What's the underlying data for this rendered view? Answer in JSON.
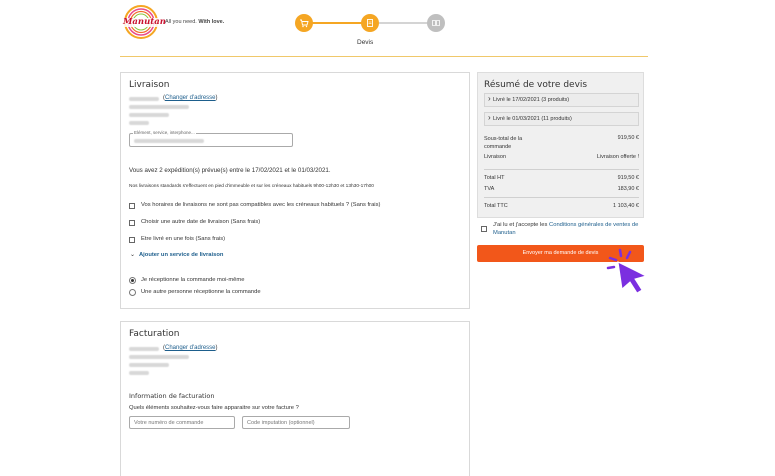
{
  "header": {
    "logo_text": "Manutan",
    "tagline_prefix": "All you need.",
    "tagline_bold": "With love.",
    "steps": [
      {
        "name": "cart",
        "state": "done"
      },
      {
        "name": "quote",
        "state": "active"
      },
      {
        "name": "confirmation",
        "state": "inactive"
      }
    ],
    "active_step_label": "Devis"
  },
  "colors": {
    "accent": "#f5a623",
    "cta": "#f2571a",
    "link": "#1d5e8c",
    "inactive": "#bfbfbf",
    "cursor": "#7b2fe0"
  },
  "livraison": {
    "title": "Livraison",
    "change_address": "Changer d'adresse",
    "contact_field_label": "Elément, service, interphone...",
    "expeditions_text": "Vous avez 2 expédition(s) prévue(s) entre le 17/02/2021 et le 01/03/2021.",
    "standard_text": "Nos livraisons standards s'effectuent en pied d'immeuble et sur les créneaux habituels 9h00-12h30 et 13h30-17h00",
    "options": [
      "Vos horaires de livraisons ne sont pas compatibles avec les créneaux habituels ? (Sans frais)",
      "Choisir une autre date de livraison (Sans frais)",
      "Etre livré en une fois (Sans frais)"
    ],
    "add_service": "Ajouter un service de livraison",
    "receiver_options": [
      "Je réceptionne la commande moi-même",
      "Une autre personne réceptionne la commande"
    ],
    "receiver_selected": 0
  },
  "facturation": {
    "title": "Facturation",
    "change_address": "Changer d'adresse",
    "info_title": "Information de facturation",
    "question": "Quels éléments souhaitez-vous faire apparaitre sur votre facture ?",
    "order_number_placeholder": "Votre numéro de commande",
    "imputation_placeholder": "Code imputation  (optionnel)"
  },
  "summary": {
    "title": "Résumé de votre devis",
    "deliveries": [
      "Livré le 17/02/2021 (3 produits)",
      "Livré le 01/03/2021 (11 produits)"
    ],
    "subtotal_label": "Sous-total de la commande",
    "subtotal_value": "919,50 €",
    "delivery_label": "Livraison",
    "delivery_value": "Livraison offerte !",
    "total_ht_label": "Total HT",
    "total_ht_value": "919,50 €",
    "tva_label": "TVA",
    "tva_value": "183,90 €",
    "total_ttc_label": "Total TTC",
    "total_ttc_value": "1 103,40 €"
  },
  "terms": {
    "prefix": "J'ai lu et j'accepte les",
    "link": "Conditions générales de ventes de Manutan"
  },
  "cta_label": "Envoyer ma demande de devis"
}
